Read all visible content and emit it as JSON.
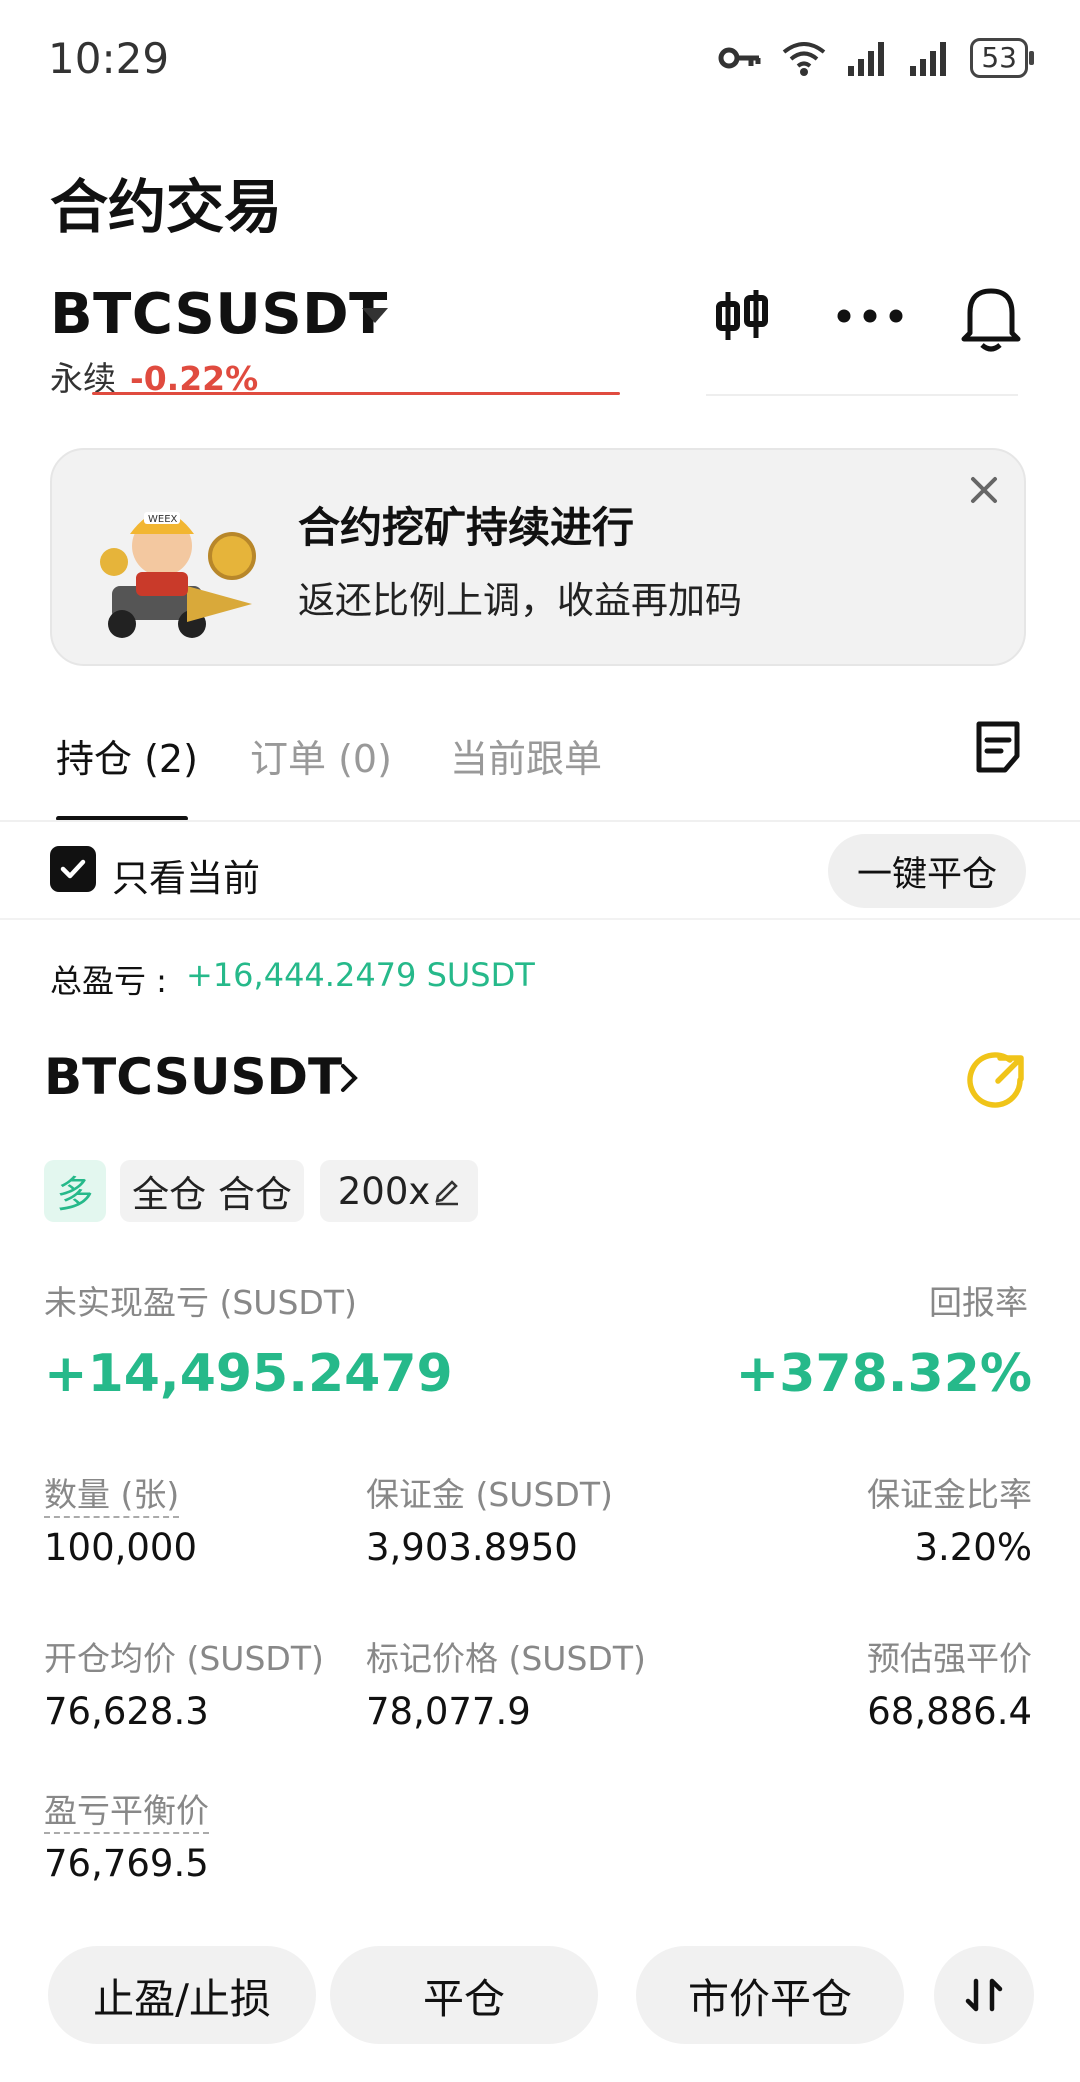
{
  "status": {
    "time": "10:29",
    "battery": "53"
  },
  "page_title": "合约交易",
  "instrument": {
    "symbol": "BTCSUSDT",
    "type_label": "永续",
    "change": "-0.22%"
  },
  "banner": {
    "title": "合约挖矿持续进行",
    "subtitle": "返还比例上调，收益再加码",
    "badge": "WEEX"
  },
  "tabs": [
    {
      "label": "持仓 (2)"
    },
    {
      "label": "订单 (0)"
    },
    {
      "label": "当前跟单"
    }
  ],
  "filter": {
    "only_current_label": "只看当前",
    "close_all_label": "一键平仓"
  },
  "total_pnl": {
    "label": "总盈亏 :",
    "value": "+16,444.2479 SUSDT"
  },
  "position": {
    "symbol": "BTCSUSDT",
    "side": "多",
    "margin_mode": "全仓 合仓",
    "leverage": "200x",
    "unrealized_label": "未实现盈亏 (SUSDT)",
    "unrealized_value": "+14,495.2479",
    "roe_label": "回报率",
    "roe_value": "+378.32%",
    "quantity_label": "数量 (张)",
    "quantity_value": "100,000",
    "margin_label": "保证金 (SUSDT)",
    "margin_value": "3,903.8950",
    "margin_ratio_label": "保证金比率",
    "margin_ratio_value": "3.20%",
    "entry_label": "开仓均价 (SUSDT)",
    "entry_value": "76,628.3",
    "mark_label": "标记价格 (SUSDT)",
    "mark_value": "78,077.9",
    "liq_label": "预估强平价",
    "liq_value": "68,886.4",
    "breakeven_label": "盈亏平衡价",
    "breakeven_value": "76,769.5"
  },
  "actions": {
    "tp_sl": "止盈/止损",
    "close": "平仓",
    "market_close": "市价平仓"
  },
  "colors": {
    "green": "#26b98a",
    "red": "#e04b3f",
    "share_yellow": "#f0c419"
  }
}
